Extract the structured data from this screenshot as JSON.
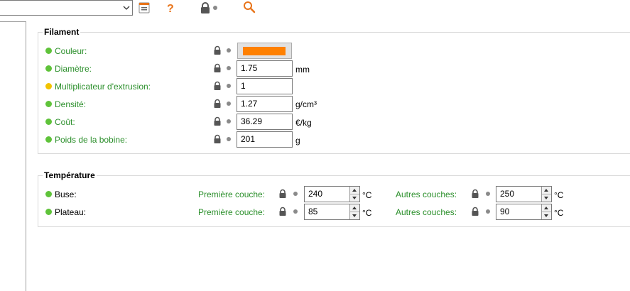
{
  "toolbar": {
    "preset_value": "",
    "icons": [
      "save-icon",
      "help-icon",
      "lock-icon",
      "search-icon"
    ]
  },
  "filament": {
    "title": "Filament",
    "rows": [
      {
        "label": "Couleur:",
        "status": "ok"
      },
      {
        "label": "Diamètre:",
        "value": "1.75",
        "unit": "mm",
        "status": "ok"
      },
      {
        "label": "Multiplicateur d'extrusion:",
        "value": "1",
        "unit": "",
        "status": "warn"
      },
      {
        "label": "Densité:",
        "value": "1.27",
        "unit": "g/cm³",
        "status": "ok"
      },
      {
        "label": "Coût:",
        "value": "36.29",
        "unit": "€/kg",
        "status": "ok"
      },
      {
        "label": "Poids de la bobine:",
        "value": "201",
        "unit": "g",
        "status": "ok"
      }
    ],
    "color_value": "#ff8000"
  },
  "temperature": {
    "title": "Température",
    "rows": [
      {
        "label": "Buse:",
        "first_layer_label": "Première couche:",
        "first_layer_value": "240",
        "other_layers_label": "Autres couches:",
        "other_layers_value": "250",
        "unit": "°C"
      },
      {
        "label": "Plateau:",
        "first_layer_label": "Première couche:",
        "first_layer_value": "85",
        "other_layers_label": "Autres couches:",
        "other_layers_value": "90",
        "unit": "°C"
      }
    ]
  },
  "colors": {
    "ok_dot": "#5fc33a",
    "warn_dot": "#f2c300",
    "green_label": "#2b8f2b",
    "accent_orange": "#e8741a",
    "swatch": "#ff8000"
  }
}
